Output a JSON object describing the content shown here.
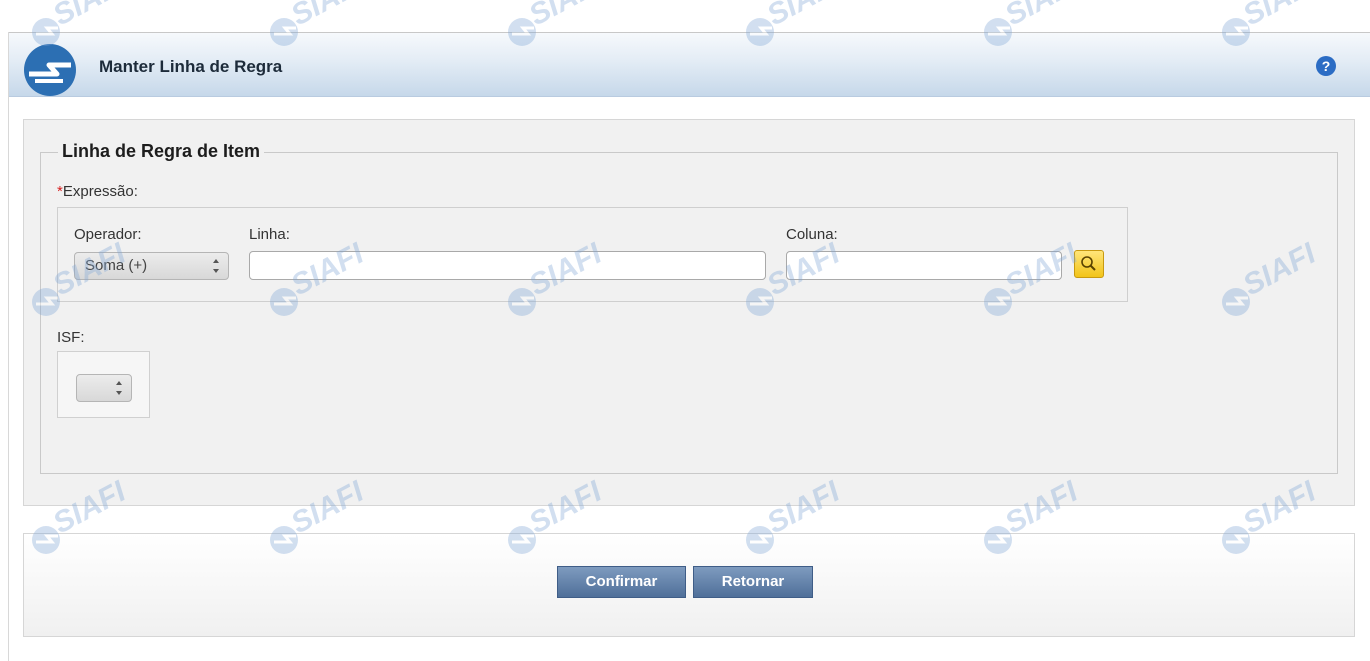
{
  "header": {
    "title": "Manter Linha de Regra",
    "help_label": "?"
  },
  "form": {
    "legend": "Linha de Regra de Item",
    "required_mark": "*",
    "expression_label": "Expressão:",
    "operator_label": "Operador:",
    "operator_value": "Soma (+)",
    "line_label": "Linha:",
    "line_value": "",
    "column_label": "Coluna:",
    "column_value": "",
    "isf_label": "ISF:",
    "isf_value": ""
  },
  "actions": {
    "confirm_label": "Confirmar",
    "return_label": "Retornar"
  },
  "icons": {
    "logo": "siafi-logo-icon",
    "help": "help-icon",
    "search": "magnifier-icon",
    "select_arrows": "updown-arrows-icon"
  },
  "watermark_text": "SIAFI",
  "colors": {
    "header_gradient_end": "#c6d8ea",
    "button_blue": "#4f6f99",
    "search_yellow": "#f2c419",
    "required_red": "#d62020",
    "help_blue": "#2b6cc4"
  }
}
